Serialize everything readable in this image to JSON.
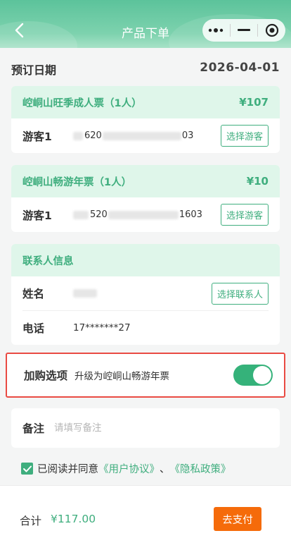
{
  "header": {
    "title": "产品下单",
    "back_icon": "chevron-left-icon",
    "capsule": {
      "more_icon": "more-dots-icon",
      "minimize_icon": "minus-icon",
      "close_icon": "target-circle-icon"
    }
  },
  "booking": {
    "date_label": "预订日期",
    "date_value": "2026-04-01"
  },
  "tickets": [
    {
      "name": "崆峒山旺季成人票（1人）",
      "price": "¥107",
      "visitor_label": "游客1",
      "id_visible_mid": "620",
      "id_visible_end": "03",
      "select_button": "选择游客"
    },
    {
      "name": "崆峒山畅游年票（1人）",
      "price": "¥10",
      "visitor_label": "游客1",
      "id_visible_mid": "520",
      "id_visible_end": "1603",
      "select_button": "选择游客"
    }
  ],
  "contact": {
    "section_title": "联系人信息",
    "name_label": "姓名",
    "select_button": "选择联系人",
    "phone_label": "电话",
    "phone_value": "17*******27"
  },
  "addon": {
    "title": "加购选项",
    "description": "升级为崆峒山畅游年票",
    "toggle_on": true
  },
  "remark": {
    "label": "备注",
    "placeholder": "请填写备注"
  },
  "agreement": {
    "text": "已阅读并同意",
    "link_user": "《用户协议》",
    "separator": "、",
    "link_privacy": "《隐私政策》",
    "checked": true
  },
  "footer": {
    "total_label": "合计",
    "total_value": "¥117.00",
    "pay_button": "去支付"
  },
  "colors": {
    "accent": "#3fae7e",
    "header_bg": "#5cc39b",
    "pay": "#f56b0a",
    "highlight_border": "#e94b43"
  }
}
